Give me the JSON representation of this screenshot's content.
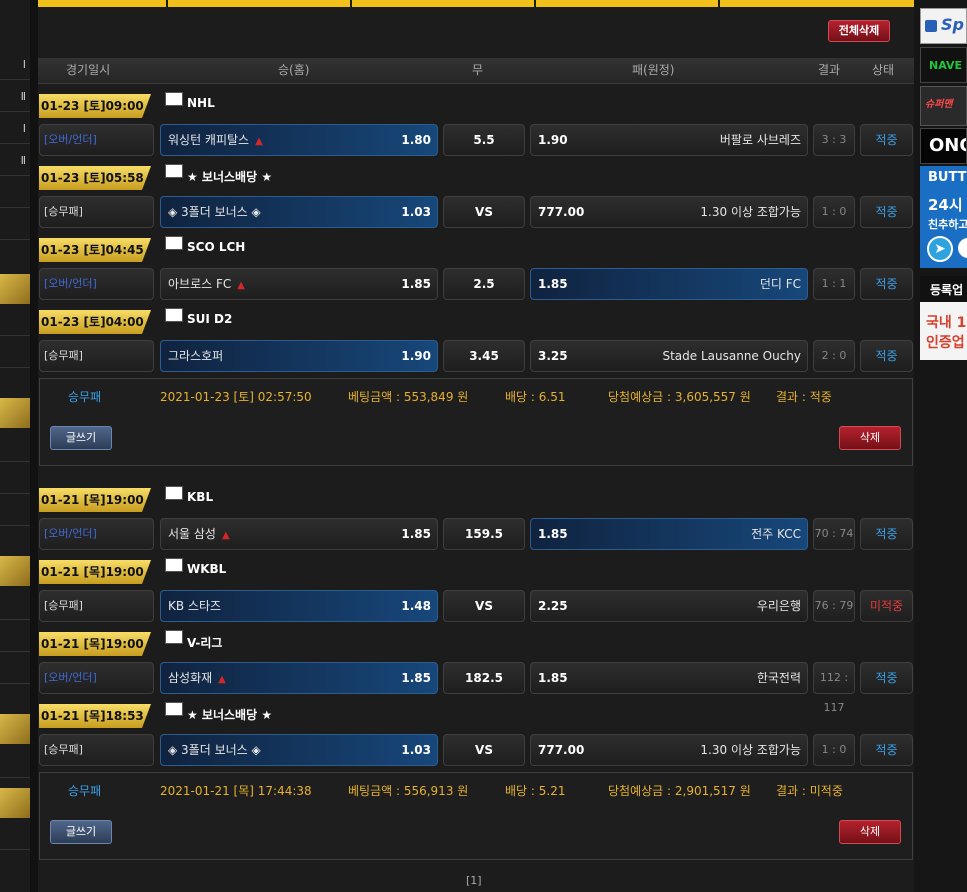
{
  "left_strip": [
    "Ⅰ",
    "Ⅱ",
    "Ⅰ",
    "Ⅱ"
  ],
  "header": {
    "delete_all": "전체삭제",
    "cols": {
      "time": "경기일시",
      "home": "승(홈)",
      "draw": "무",
      "away": "패(원정)",
      "result": "결과",
      "status": "상태"
    }
  },
  "bets": [
    {
      "games": [
        {
          "date": "01-23 [토]09:00",
          "league": "NHL",
          "type": "[오버/언더]",
          "type_kind": "ou",
          "home": "워싱턴 캐피탈스",
          "home_odds": "1.80",
          "home_up": true,
          "draw": "5.5",
          "away_odds": "1.90",
          "away": "버팔로 사브레즈",
          "score": "3 : 3",
          "status": "적중",
          "status_kind": "hit",
          "sel": "home"
        },
        {
          "date": "01-23 [토]05:58",
          "league": "★ 보너스배당 ★",
          "type": "[승무패]",
          "type_kind": "wdl",
          "home": "◈ 3폴더 보너스 ◈",
          "home_odds": "1.03",
          "home_up": false,
          "draw": "VS",
          "away_odds": "777.00",
          "away": "1.30 이상 조합가능",
          "score": "1 : 0",
          "status": "적중",
          "status_kind": "hit",
          "sel": "home"
        },
        {
          "date": "01-23 [토]04:45",
          "league": "SCO LCH",
          "type": "[오버/언더]",
          "type_kind": "ou",
          "home": "아브로스 FC",
          "home_odds": "1.85",
          "home_up": true,
          "draw": "2.5",
          "away_odds": "1.85",
          "away": "던디 FC",
          "score": "1 : 1",
          "status": "적중",
          "status_kind": "hit",
          "sel": "away"
        },
        {
          "date": "01-23 [토]04:00",
          "league": "SUI D2",
          "type": "[승무패]",
          "type_kind": "wdl",
          "home": "그라스호퍼",
          "home_odds": "1.90",
          "home_up": false,
          "draw": "3.45",
          "away_odds": "3.25",
          "away": "Stade Lausanne Ouchy",
          "score": "2 : 0",
          "status": "적중",
          "status_kind": "hit",
          "sel": "home"
        }
      ],
      "summary": {
        "type": "승무패",
        "datetime": "2021-01-23 [토] 02:57:50",
        "amount": "베팅금액 : 553,849 원",
        "odds": "배당 : 6.51",
        "expected": "당첨예상금 : 3,605,557 원",
        "result": "결과 : 적중"
      }
    },
    {
      "games": [
        {
          "date": "01-21 [목]19:00",
          "league": "KBL",
          "type": "[오버/언더]",
          "type_kind": "ou",
          "home": "서울 삼성",
          "home_odds": "1.85",
          "home_up": true,
          "draw": "159.5",
          "away_odds": "1.85",
          "away": "전주 KCC",
          "score": "70 : 74",
          "status": "적중",
          "status_kind": "hit",
          "sel": "away"
        },
        {
          "date": "01-21 [목]19:00",
          "league": "WKBL",
          "type": "[승무패]",
          "type_kind": "wdl",
          "home": "KB 스타즈",
          "home_odds": "1.48",
          "home_up": false,
          "draw": "VS",
          "away_odds": "2.25",
          "away": "우리은행",
          "score": "76 : 79",
          "status": "미적중",
          "status_kind": "miss",
          "sel": "home"
        },
        {
          "date": "01-21 [목]19:00",
          "league": "V-리그",
          "type": "[오버/언더]",
          "type_kind": "ou",
          "home": "삼성화재",
          "home_odds": "1.85",
          "home_up": true,
          "draw": "182.5",
          "away_odds": "1.85",
          "away": "한국전력",
          "score": "112 : 117",
          "status": "적중",
          "status_kind": "hit",
          "sel": "home"
        },
        {
          "date": "01-21 [목]18:53",
          "league": "★ 보너스배당 ★",
          "type": "[승무패]",
          "type_kind": "wdl",
          "home": "◈ 3폴더 보너스 ◈",
          "home_odds": "1.03",
          "home_up": false,
          "draw": "VS",
          "away_odds": "777.00",
          "away": "1.30 이상 조합가능",
          "score": "1 : 0",
          "status": "적중",
          "status_kind": "hit",
          "sel": "home"
        }
      ],
      "summary": {
        "type": "승무패",
        "datetime": "2021-01-21 [목] 17:44:38",
        "amount": "베팅금액 : 556,913 원",
        "odds": "배당 : 5.21",
        "expected": "당첨예상금 : 2,901,517 원",
        "result": "결과 : 미적중"
      }
    }
  ],
  "buttons": {
    "write": "글쓰기",
    "delete": "삭제"
  },
  "pager": "[1]",
  "banners": {
    "b1": "Sp",
    "b2": "NAVE",
    "b3": "슈퍼맨",
    "b4": "ONO",
    "b5": "BUTT",
    "b6a": "24시",
    "b6b": "친추하고",
    "b7": "등록업",
    "b8a": "국내 1",
    "b8b": "인증업"
  },
  "colors": {
    "accent_gold": "#f0c11a",
    "status_hit": "#3aa0e8",
    "status_miss": "#e63a3a",
    "ou_type": "#3f6ad6"
  }
}
